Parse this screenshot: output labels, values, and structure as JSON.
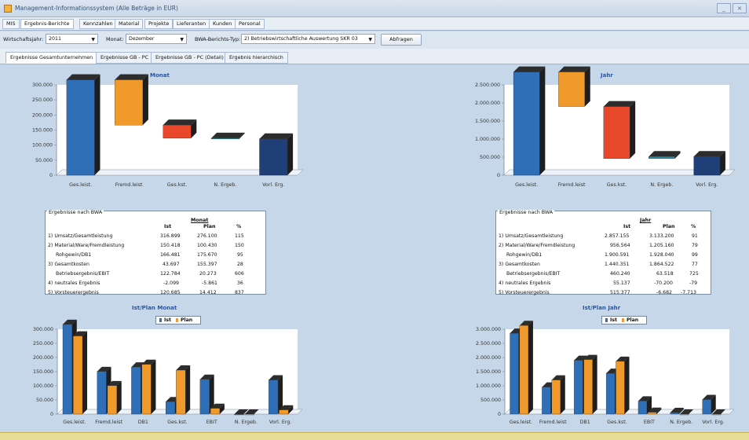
{
  "window": {
    "title": "Management-Informationssystem (Alle Beträge in EUR)",
    "minimize": "_",
    "close": "×"
  },
  "menu": [
    "MIS",
    "Ergebnis-Berichte",
    "Kennzahlen",
    "Material",
    "Projekte",
    "Lieferanten",
    "Kunden",
    "Personal"
  ],
  "filters": {
    "year_label": "Wirtschaftsjahr:",
    "year_value": "2011",
    "month_label": "Monat:",
    "month_value": "Dezember",
    "bwa_label": "BWA-Berichts-Typ:",
    "bwa_value": "2) Betriebswirtschaftliche Auswertung SKR 03",
    "query_button": "Abfragen"
  },
  "tabs": [
    "Ergebnisse Gesamtunternehmen",
    "Ergebnisse GB - PC",
    "Ergebnisse GB - PC (Detail)",
    "Ergebnis hierarchisch"
  ],
  "colors": {
    "blue": "#2f6fb7",
    "orange": "#f19a2c",
    "red": "#e9472a",
    "teal": "#2f8a9f",
    "navy": "#1e3f78",
    "dark": "#1f1f1f",
    "chart_bg": "#ffffff"
  },
  "chart_data": [
    {
      "type": "bar",
      "title": "Monat",
      "categories": [
        "Ges.leist.",
        "Fremd.leist",
        "Ges.kst.",
        "N. Ergeb.",
        "Vorl. Erg."
      ],
      "series": [
        {
          "values": [
            316899,
            150418,
            43697,
            -2099,
            120685
          ]
        }
      ],
      "ylim": [
        0,
        300000
      ],
      "ticks": [
        "0",
        "50.000",
        "100.000",
        "150.000",
        "200.000",
        "250.000",
        "300.000"
      ],
      "waterfall": [
        [
          0,
          316899
        ],
        [
          166481,
          316899
        ],
        [
          122784,
          166481
        ],
        [
          120685,
          122784
        ],
        [
          0,
          120685
        ]
      ],
      "colors": [
        "#2f6fb7",
        "#f19a2c",
        "#e9472a",
        "#2f8a9f",
        "#1e3f78"
      ]
    },
    {
      "type": "bar",
      "title": "Jahr",
      "categories": [
        "Ges.leist.",
        "Fremd.leist",
        "Ges.kst.",
        "N. Ergeb.",
        "Vorl. Erg."
      ],
      "series": [
        {
          "values": [
            2857155,
            956564,
            1440351,
            55137,
            515377
          ]
        }
      ],
      "ylim": [
        0,
        2500000
      ],
      "ticks": [
        "0",
        "500.000",
        "1.000.000",
        "1.500.000",
        "2.000.000",
        "2.500.000"
      ],
      "waterfall": [
        [
          0,
          2857155
        ],
        [
          1900591,
          2857155
        ],
        [
          460240,
          1900591
        ],
        [
          460240,
          515377
        ],
        [
          0,
          515377
        ]
      ],
      "colors": [
        "#2f6fb7",
        "#f19a2c",
        "#e9472a",
        "#2f8a9f",
        "#1e3f78"
      ]
    },
    {
      "type": "bar",
      "title": "Ist/Plan Monat",
      "categories": [
        "Ges.leist.",
        "Fremd.leist",
        "DB1",
        "Ges.kst.",
        "EBIT",
        "N. Ergeb.",
        "Vorl. Erg."
      ],
      "series": [
        {
          "name": "Ist",
          "values": [
            316899,
            150418,
            166481,
            43697,
            122784,
            -2099,
            120685
          ],
          "color": "#2f6fb7"
        },
        {
          "name": "Plan",
          "values": [
            276100,
            100430,
            175670,
            155397,
            20273,
            -5861,
            14412
          ],
          "color": "#f19a2c"
        }
      ],
      "ylim": [
        0,
        300000
      ],
      "ticks": [
        "0",
        "50.000",
        "100.000",
        "150.000",
        "200.000",
        "250.000",
        "300.000"
      ]
    },
    {
      "type": "bar",
      "title": "Ist/Plan Jahr",
      "categories": [
        "Ges.leist.",
        "Fremd.leist",
        "DB1",
        "Ges.kst.",
        "EBIT",
        "N. Ergeb.",
        "Vorl. Erg."
      ],
      "series": [
        {
          "name": "Ist",
          "values": [
            2857155,
            956564,
            1900591,
            1440351,
            460240,
            55137,
            515377
          ],
          "color": "#2f6fb7"
        },
        {
          "name": "Plan",
          "values": [
            3133200,
            1205160,
            1928040,
            1864522,
            63518,
            -70200,
            -6682
          ],
          "color": "#f19a2c"
        }
      ],
      "ylim": [
        0,
        3000000
      ],
      "ticks": [
        "0",
        "500.000",
        "1.000.000",
        "1.500.000",
        "2.000.000",
        "2.500.000",
        "3.000.000"
      ]
    }
  ],
  "tables": {
    "month": {
      "title": "Ergebnisse nach BWA",
      "period": "Monat",
      "headers": [
        "Ist",
        "Plan",
        "%"
      ],
      "rows": [
        [
          "1) Umsatz/Gesamtleistung",
          "316.899",
          "276.100",
          "115"
        ],
        [
          "2) Material/Ware/Fremdleistung",
          "150.418",
          "100.430",
          "150"
        ],
        [
          "Rohgewin/DB1",
          "166.481",
          "175.670",
          "95"
        ],
        [
          "3) Gesamtkosten",
          "43.697",
          "155.397",
          "28"
        ],
        [
          "Betriebsergebnis/EBIT",
          "122.784",
          "20.273",
          "606"
        ],
        [
          "4) neutrales Ergebnis",
          "-2.099",
          "-5.861",
          "36"
        ],
        [
          "5) Vorsteuerergebnis",
          "120.685",
          "14.412",
          "837"
        ]
      ]
    },
    "year": {
      "title": "Ergebnisse nach BWA",
      "period": "Jahr",
      "headers": [
        "Ist",
        "Plan",
        "%"
      ],
      "rows": [
        [
          "1) Umsatz/Gesamtleistung",
          "2.857.155",
          "3.133.200",
          "91"
        ],
        [
          "2) Material/Ware/Fremdleistung",
          "956.564",
          "1.205.160",
          "79"
        ],
        [
          "Rohgewin/DB1",
          "1.900.591",
          "1.928.040",
          "99"
        ],
        [
          "3) Gesamtkosten",
          "1.440.351",
          "1.864.522",
          "77"
        ],
        [
          "Betriebsergebnis/EBIT",
          "460.240",
          "63.518",
          "725"
        ],
        [
          "4) neutrales Ergebnis",
          "55.137",
          "-70.200",
          "-79"
        ],
        [
          "5) Vorsteuerergebnis",
          "515.377",
          "-6.682",
          "-7.713"
        ]
      ]
    }
  }
}
